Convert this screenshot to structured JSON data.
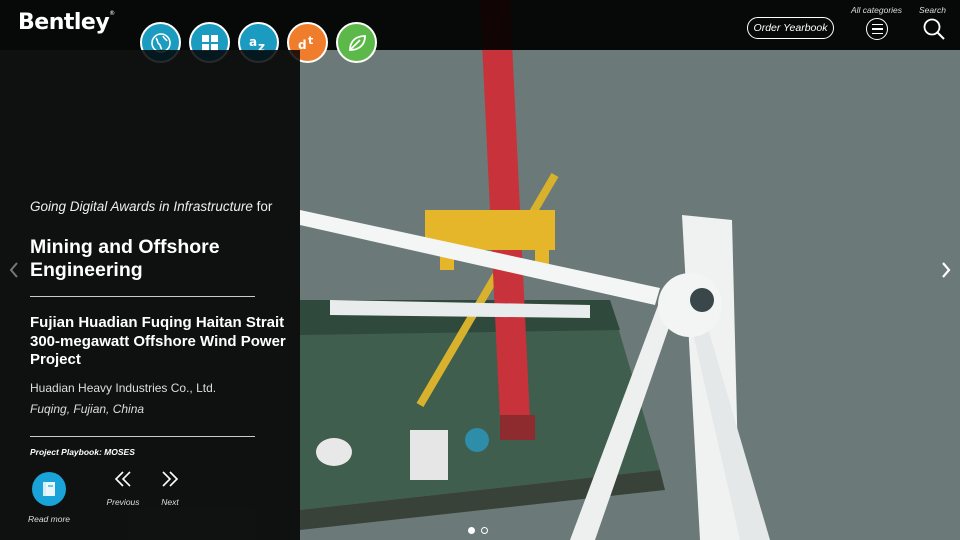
{
  "brand": {
    "logo_text": "Bentley",
    "registered": "®"
  },
  "category_icons": [
    {
      "name": "globe-icon",
      "color": "#1a9bbf"
    },
    {
      "name": "grid-icon",
      "color": "#1a9bbf"
    },
    {
      "name": "az-icon",
      "color": "#1a9bbf"
    },
    {
      "name": "dt-icon",
      "color": "#f07d2b"
    },
    {
      "name": "leaf-icon",
      "color": "#5cb848"
    }
  ],
  "header": {
    "order_label": "Order Yearbook",
    "all_categories_label": "All categories",
    "search_label": "Search"
  },
  "panel": {
    "award_line": "Going Digital Awards in Infrastructure",
    "award_for": "for",
    "category": "Mining and Offshore Engineering",
    "project_title": "Fujian Huadian Fuqing Haitan Strait 300-megawatt Offshore Wind Power Project",
    "organization": "Huadian Heavy Industries Co., Ltd.",
    "location": "Fuqing, Fujian, China",
    "playbook": "Project Playbook: MOSES",
    "read_more": "Read more",
    "previous": "Previous",
    "next": "Next"
  },
  "slides": {
    "count": 2,
    "active": 1
  }
}
